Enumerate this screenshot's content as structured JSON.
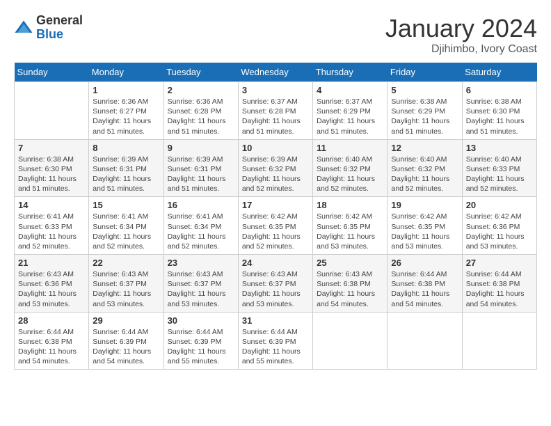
{
  "logo": {
    "general": "General",
    "blue": "Blue"
  },
  "title": "January 2024",
  "location": "Djihimbo, Ivory Coast",
  "days_of_week": [
    "Sunday",
    "Monday",
    "Tuesday",
    "Wednesday",
    "Thursday",
    "Friday",
    "Saturday"
  ],
  "weeks": [
    [
      {
        "day": "",
        "sunrise": "",
        "sunset": "",
        "daylight": ""
      },
      {
        "day": "1",
        "sunrise": "Sunrise: 6:36 AM",
        "sunset": "Sunset: 6:27 PM",
        "daylight": "Daylight: 11 hours and 51 minutes."
      },
      {
        "day": "2",
        "sunrise": "Sunrise: 6:36 AM",
        "sunset": "Sunset: 6:28 PM",
        "daylight": "Daylight: 11 hours and 51 minutes."
      },
      {
        "day": "3",
        "sunrise": "Sunrise: 6:37 AM",
        "sunset": "Sunset: 6:28 PM",
        "daylight": "Daylight: 11 hours and 51 minutes."
      },
      {
        "day": "4",
        "sunrise": "Sunrise: 6:37 AM",
        "sunset": "Sunset: 6:29 PM",
        "daylight": "Daylight: 11 hours and 51 minutes."
      },
      {
        "day": "5",
        "sunrise": "Sunrise: 6:38 AM",
        "sunset": "Sunset: 6:29 PM",
        "daylight": "Daylight: 11 hours and 51 minutes."
      },
      {
        "day": "6",
        "sunrise": "Sunrise: 6:38 AM",
        "sunset": "Sunset: 6:30 PM",
        "daylight": "Daylight: 11 hours and 51 minutes."
      }
    ],
    [
      {
        "day": "7",
        "sunrise": "Sunrise: 6:38 AM",
        "sunset": "Sunset: 6:30 PM",
        "daylight": "Daylight: 11 hours and 51 minutes."
      },
      {
        "day": "8",
        "sunrise": "Sunrise: 6:39 AM",
        "sunset": "Sunset: 6:31 PM",
        "daylight": "Daylight: 11 hours and 51 minutes."
      },
      {
        "day": "9",
        "sunrise": "Sunrise: 6:39 AM",
        "sunset": "Sunset: 6:31 PM",
        "daylight": "Daylight: 11 hours and 51 minutes."
      },
      {
        "day": "10",
        "sunrise": "Sunrise: 6:39 AM",
        "sunset": "Sunset: 6:32 PM",
        "daylight": "Daylight: 11 hours and 52 minutes."
      },
      {
        "day": "11",
        "sunrise": "Sunrise: 6:40 AM",
        "sunset": "Sunset: 6:32 PM",
        "daylight": "Daylight: 11 hours and 52 minutes."
      },
      {
        "day": "12",
        "sunrise": "Sunrise: 6:40 AM",
        "sunset": "Sunset: 6:32 PM",
        "daylight": "Daylight: 11 hours and 52 minutes."
      },
      {
        "day": "13",
        "sunrise": "Sunrise: 6:40 AM",
        "sunset": "Sunset: 6:33 PM",
        "daylight": "Daylight: 11 hours and 52 minutes."
      }
    ],
    [
      {
        "day": "14",
        "sunrise": "Sunrise: 6:41 AM",
        "sunset": "Sunset: 6:33 PM",
        "daylight": "Daylight: 11 hours and 52 minutes."
      },
      {
        "day": "15",
        "sunrise": "Sunrise: 6:41 AM",
        "sunset": "Sunset: 6:34 PM",
        "daylight": "Daylight: 11 hours and 52 minutes."
      },
      {
        "day": "16",
        "sunrise": "Sunrise: 6:41 AM",
        "sunset": "Sunset: 6:34 PM",
        "daylight": "Daylight: 11 hours and 52 minutes."
      },
      {
        "day": "17",
        "sunrise": "Sunrise: 6:42 AM",
        "sunset": "Sunset: 6:35 PM",
        "daylight": "Daylight: 11 hours and 52 minutes."
      },
      {
        "day": "18",
        "sunrise": "Sunrise: 6:42 AM",
        "sunset": "Sunset: 6:35 PM",
        "daylight": "Daylight: 11 hours and 53 minutes."
      },
      {
        "day": "19",
        "sunrise": "Sunrise: 6:42 AM",
        "sunset": "Sunset: 6:35 PM",
        "daylight": "Daylight: 11 hours and 53 minutes."
      },
      {
        "day": "20",
        "sunrise": "Sunrise: 6:42 AM",
        "sunset": "Sunset: 6:36 PM",
        "daylight": "Daylight: 11 hours and 53 minutes."
      }
    ],
    [
      {
        "day": "21",
        "sunrise": "Sunrise: 6:43 AM",
        "sunset": "Sunset: 6:36 PM",
        "daylight": "Daylight: 11 hours and 53 minutes."
      },
      {
        "day": "22",
        "sunrise": "Sunrise: 6:43 AM",
        "sunset": "Sunset: 6:37 PM",
        "daylight": "Daylight: 11 hours and 53 minutes."
      },
      {
        "day": "23",
        "sunrise": "Sunrise: 6:43 AM",
        "sunset": "Sunset: 6:37 PM",
        "daylight": "Daylight: 11 hours and 53 minutes."
      },
      {
        "day": "24",
        "sunrise": "Sunrise: 6:43 AM",
        "sunset": "Sunset: 6:37 PM",
        "daylight": "Daylight: 11 hours and 53 minutes."
      },
      {
        "day": "25",
        "sunrise": "Sunrise: 6:43 AM",
        "sunset": "Sunset: 6:38 PM",
        "daylight": "Daylight: 11 hours and 54 minutes."
      },
      {
        "day": "26",
        "sunrise": "Sunrise: 6:44 AM",
        "sunset": "Sunset: 6:38 PM",
        "daylight": "Daylight: 11 hours and 54 minutes."
      },
      {
        "day": "27",
        "sunrise": "Sunrise: 6:44 AM",
        "sunset": "Sunset: 6:38 PM",
        "daylight": "Daylight: 11 hours and 54 minutes."
      }
    ],
    [
      {
        "day": "28",
        "sunrise": "Sunrise: 6:44 AM",
        "sunset": "Sunset: 6:38 PM",
        "daylight": "Daylight: 11 hours and 54 minutes."
      },
      {
        "day": "29",
        "sunrise": "Sunrise: 6:44 AM",
        "sunset": "Sunset: 6:39 PM",
        "daylight": "Daylight: 11 hours and 54 minutes."
      },
      {
        "day": "30",
        "sunrise": "Sunrise: 6:44 AM",
        "sunset": "Sunset: 6:39 PM",
        "daylight": "Daylight: 11 hours and 55 minutes."
      },
      {
        "day": "31",
        "sunrise": "Sunrise: 6:44 AM",
        "sunset": "Sunset: 6:39 PM",
        "daylight": "Daylight: 11 hours and 55 minutes."
      },
      {
        "day": "",
        "sunrise": "",
        "sunset": "",
        "daylight": ""
      },
      {
        "day": "",
        "sunrise": "",
        "sunset": "",
        "daylight": ""
      },
      {
        "day": "",
        "sunrise": "",
        "sunset": "",
        "daylight": ""
      }
    ]
  ]
}
